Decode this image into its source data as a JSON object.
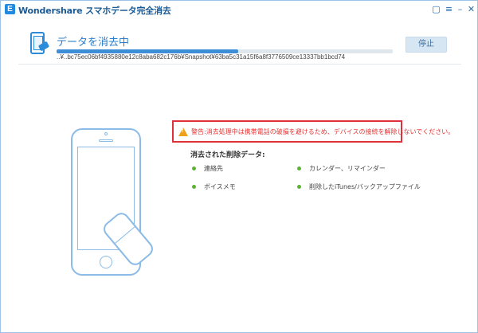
{
  "window": {
    "logo_glyph": "E",
    "title": "Wondershare スマホデータ完全消去",
    "controls": {
      "feedback": "▢",
      "menu": "≡",
      "minimize": "–",
      "close": "✕"
    }
  },
  "progress": {
    "heading": "データを消去中",
    "fraction": 0.54,
    "path": "..¥..bc75ec06bf4935880e12c8aba682c176b¥Snapshot¥63ba5c31a15f6a8f3776509ce13337bb1bcd74",
    "stop_label": "停止"
  },
  "warning": {
    "label": "警告:",
    "text": "消去処理中は携帯電話の破損を避けるため、デバイスの接続を解除しないでください。"
  },
  "erased_data": {
    "heading": "消去された削除データ:",
    "items": [
      "連絡先",
      "カレンダー、リマインダー",
      "ボイスメモ",
      "削除したiTunes/バックアップファイル"
    ]
  },
  "colors": {
    "accent": "#2b7cc8",
    "progress": "#3d8ed6",
    "warning_border": "#e0303c",
    "warning_text": "#e53232",
    "dot": "#5cb531"
  }
}
